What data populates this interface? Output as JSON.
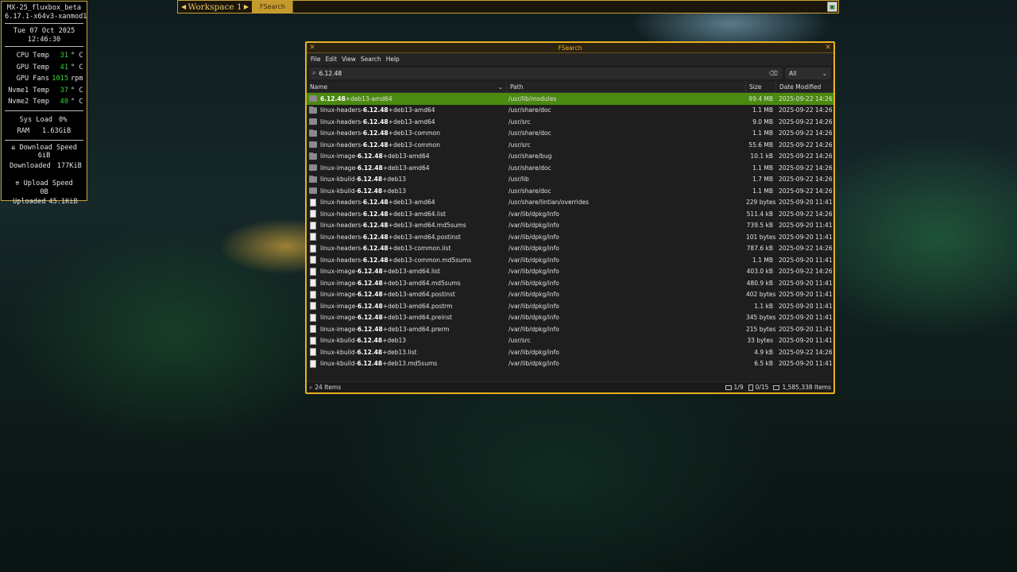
{
  "conky": {
    "hostname": "MX-25_fluxbox_beta",
    "kernel": "6.17.1-x64v3-xanmod1",
    "date": "Tue 07 Oct 2025",
    "time": "12:46:30",
    "sensors": [
      {
        "label": "CPU Temp",
        "value": "31",
        "unit": "° C"
      },
      {
        "label": "GPU Temp",
        "value": "41",
        "unit": "° C"
      },
      {
        "label": "GPU Fans",
        "value": "1015",
        "unit": "rpm"
      },
      {
        "label": "Nvme1 Temp",
        "value": "37",
        "unit": "° C"
      },
      {
        "label": "Nvme2 Temp",
        "value": "40",
        "unit": "° C"
      }
    ],
    "sys_load_label": "Sys Load",
    "sys_load": "0%",
    "ram_label": "RAM",
    "ram": "1.63GiB",
    "download_speed_label": "⇊ Download Speed",
    "download_speed": "6iB",
    "downloaded_label": "Downloaded",
    "downloaded": "177KiB",
    "upload_speed_label": "⇈ Upload Speed",
    "upload_speed": "0B",
    "uploaded_label": "Uploaded",
    "uploaded": "45.1KiB",
    "value_color": "#3ad43a"
  },
  "toolbar": {
    "workspace": "Workspace 1",
    "prev_icon": "left-arrow-icon",
    "next_icon": "right-arrow-icon",
    "task": "FSearch",
    "accent": "#c8a233"
  },
  "window": {
    "title": "FSearch",
    "menu": [
      "File",
      "Edit",
      "View",
      "Search",
      "Help"
    ],
    "search_query": "6.12.48",
    "filter": "All",
    "columns": {
      "name": "Name",
      "path": "Path",
      "size": "Size",
      "date": "Date Modified"
    },
    "highlight": "6.12.48",
    "rows": [
      {
        "type": "folder",
        "pre": "",
        "post": "+deb13-amd64",
        "path": "/usr/lib/modules",
        "size": "99.4 MB",
        "date": "2025-09-22 14:26",
        "selected": true
      },
      {
        "type": "folder",
        "pre": "linux-headers-",
        "post": "+deb13-amd64",
        "path": "/usr/share/doc",
        "size": "1.1 MB",
        "date": "2025-09-22 14:26"
      },
      {
        "type": "folder",
        "pre": "linux-headers-",
        "post": "+deb13-amd64",
        "path": "/usr/src",
        "size": "9.0 MB",
        "date": "2025-09-22 14:26"
      },
      {
        "type": "folder",
        "pre": "linux-headers-",
        "post": "+deb13-common",
        "path": "/usr/share/doc",
        "size": "1.1 MB",
        "date": "2025-09-22 14:26"
      },
      {
        "type": "folder",
        "pre": "linux-headers-",
        "post": "+deb13-common",
        "path": "/usr/src",
        "size": "55.6 MB",
        "date": "2025-09-22 14:26"
      },
      {
        "type": "folder",
        "pre": "linux-image-",
        "post": "+deb13-amd64",
        "path": "/usr/share/bug",
        "size": "10.1 kB",
        "date": "2025-09-22 14:26"
      },
      {
        "type": "folder",
        "pre": "linux-image-",
        "post": "+deb13-amd64",
        "path": "/usr/share/doc",
        "size": "1.1 MB",
        "date": "2025-09-22 14:26"
      },
      {
        "type": "folder",
        "pre": "linux-kbuild-",
        "post": "+deb13",
        "path": "/usr/lib",
        "size": "1.7 MB",
        "date": "2025-09-22 14:26"
      },
      {
        "type": "folder",
        "pre": "linux-kbuild-",
        "post": "+deb13",
        "path": "/usr/share/doc",
        "size": "1.1 MB",
        "date": "2025-09-22 14:26"
      },
      {
        "type": "file",
        "pre": "linux-headers-",
        "post": "+deb13-amd64",
        "path": "/usr/share/lintian/overrides",
        "size": "229 bytes",
        "date": "2025-09-20 11:41"
      },
      {
        "type": "file",
        "pre": "linux-headers-",
        "post": "+deb13-amd64.list",
        "path": "/var/lib/dpkg/info",
        "size": "511.4 kB",
        "date": "2025-09-22 14:26"
      },
      {
        "type": "file",
        "pre": "linux-headers-",
        "post": "+deb13-amd64.md5sums",
        "path": "/var/lib/dpkg/info",
        "size": "739.5 kB",
        "date": "2025-09-20 11:41"
      },
      {
        "type": "file",
        "pre": "linux-headers-",
        "post": "+deb13-amd64.postinst",
        "path": "/var/lib/dpkg/info",
        "size": "101 bytes",
        "date": "2025-09-20 11:41"
      },
      {
        "type": "file",
        "pre": "linux-headers-",
        "post": "+deb13-common.list",
        "path": "/var/lib/dpkg/info",
        "size": "787.6 kB",
        "date": "2025-09-22 14:26"
      },
      {
        "type": "file",
        "pre": "linux-headers-",
        "post": "+deb13-common.md5sums",
        "path": "/var/lib/dpkg/info",
        "size": "1.1 MB",
        "date": "2025-09-20 11:41"
      },
      {
        "type": "file",
        "pre": "linux-image-",
        "post": "+deb13-amd64.list",
        "path": "/var/lib/dpkg/info",
        "size": "403.0 kB",
        "date": "2025-09-22 14:26"
      },
      {
        "type": "file",
        "pre": "linux-image-",
        "post": "+deb13-amd64.md5sums",
        "path": "/var/lib/dpkg/info",
        "size": "480.9 kB",
        "date": "2025-09-20 11:41"
      },
      {
        "type": "file",
        "pre": "linux-image-",
        "post": "+deb13-amd64.postinst",
        "path": "/var/lib/dpkg/info",
        "size": "402 bytes",
        "date": "2025-09-20 11:41"
      },
      {
        "type": "file",
        "pre": "linux-image-",
        "post": "+deb13-amd64.postrm",
        "path": "/var/lib/dpkg/info",
        "size": "1.1 kB",
        "date": "2025-09-20 11:41"
      },
      {
        "type": "file",
        "pre": "linux-image-",
        "post": "+deb13-amd64.preinst",
        "path": "/var/lib/dpkg/info",
        "size": "345 bytes",
        "date": "2025-09-20 11:41"
      },
      {
        "type": "file",
        "pre": "linux-image-",
        "post": "+deb13-amd64.prerm",
        "path": "/var/lib/dpkg/info",
        "size": "215 bytes",
        "date": "2025-09-20 11:41"
      },
      {
        "type": "file",
        "pre": "linux-kbuild-",
        "post": "+deb13",
        "path": "/usr/src",
        "size": "33 bytes",
        "date": "2025-09-20 11:41"
      },
      {
        "type": "file",
        "pre": "linux-kbuild-",
        "post": "+deb13.list",
        "path": "/var/lib/dpkg/info",
        "size": "4.9 kB",
        "date": "2025-09-22 14:26"
      },
      {
        "type": "file",
        "pre": "linux-kbuild-",
        "post": "+deb13.md5sums",
        "path": "/var/lib/dpkg/info",
        "size": "6.5 kB",
        "date": "2025-09-20 11:41"
      }
    ],
    "status": {
      "items": "24 Items",
      "folders": "1/9",
      "files": "0/15",
      "total": "1,585,338 Items"
    },
    "accent": "#e8b020",
    "selection_color": "#4a8a10"
  }
}
